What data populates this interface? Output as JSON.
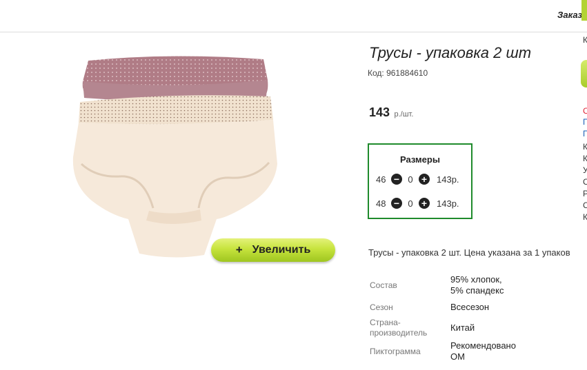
{
  "header": {
    "orders_label": "Заказы"
  },
  "product": {
    "title": "Трусы - упаковка 2 шт",
    "code": "Код: 961884610",
    "price": "143",
    "price_unit": "р./шт.",
    "zoom_plus": "+",
    "zoom_label": "Увеличить"
  },
  "sizes": {
    "title": "Размеры",
    "minus": "−",
    "plus": "+",
    "rows": [
      {
        "size": "46",
        "qty": "0",
        "price": "143р."
      },
      {
        "size": "48",
        "qty": "0",
        "price": "143р."
      }
    ]
  },
  "description": "Трусы - упаковка 2 шт. Цена указана за 1 упаков",
  "attributes": [
    {
      "label": "Состав",
      "value_line1": "95% хлопок,",
      "value_line2": "5% спандекс"
    },
    {
      "label": "Сезон",
      "value_line1": "Всесезон",
      "value_line2": ""
    },
    {
      "label_line1": "Страна-",
      "label_line2": "производитель",
      "value_line1": "Китай",
      "value_line2": ""
    },
    {
      "label": "Пиктограмма",
      "value_line1": "Рекомендовано",
      "value_line2": "ОМ"
    }
  ],
  "right_column_fragments": [
    "К",
    "С",
    "П",
    "П",
    "К",
    "К",
    "У",
    "С",
    "Р",
    "С",
    "К"
  ],
  "colors": {
    "accent_green": "#1e8a2b",
    "button_green": "#c6e33d"
  }
}
